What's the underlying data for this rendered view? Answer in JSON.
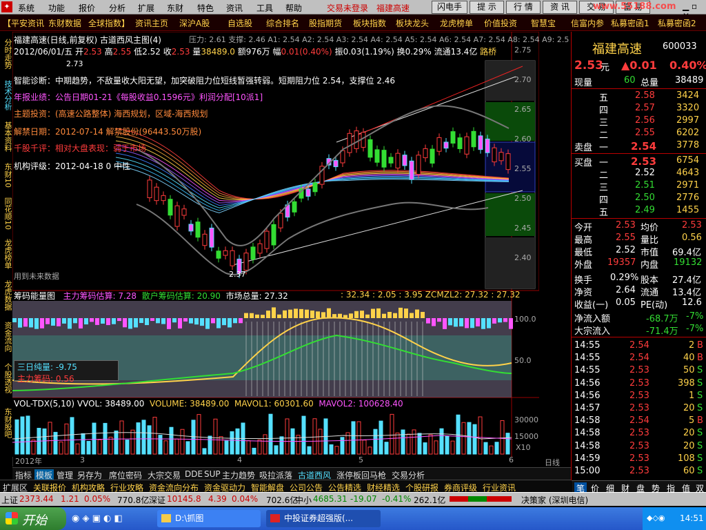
{
  "menubar": {
    "items": [
      "系统",
      "功能",
      "报价",
      "分析",
      "扩展",
      "东财",
      "特色",
      "资讯",
      "工具",
      "帮助"
    ],
    "status_login": "交易未登录",
    "status_stock": "福建高速",
    "tool_buttons": [
      "闪电手",
      "提 示",
      "行 情",
      "资 讯",
      "交 易",
      "富 易"
    ],
    "watermark": "www.55188.com"
  },
  "navbar": {
    "items": [
      "【平安资讯",
      "东财数据",
      "全球指数】",
      "资讯主页",
      "深沪A股",
      "自选股",
      "综合排名",
      "股指期货",
      "板块指数",
      "板块龙头",
      "龙虎榜单",
      "价值投资",
      "智慧宝",
      "信富内参",
      "私募密函1",
      "私募密函2"
    ]
  },
  "sidebar": {
    "tabs": [
      "分时走势",
      "技术分析",
      "基本资料",
      "东财10",
      "同花顺10",
      "龙虎榜单",
      "龙虎数据",
      "资金流向",
      "个股透视",
      "东财股吧"
    ]
  },
  "chart": {
    "title": "福建高速(日线,前复权) 古道西风主图(4)",
    "pressure": "压力: 2.61  支撑: 2.46  A1: 2.54  A2: 2.54  A3: 2.54  A4: 2.54  A5: 2.54  A6: 2.54  A7: 2.54  A8: 2.54  A9: 2.5",
    "ohlc_line": {
      "date": "2012/06/01/五",
      "open_label": "开",
      "open": "2.53",
      "high_label": "高",
      "high": "2.55",
      "low_label": "低",
      "low": "2.52",
      "close_label": "收",
      "close": "2.53",
      "vol_label": "量",
      "vol": "38489.0",
      "amount_label": "额",
      "amount": "976万",
      "change_label": "幅",
      "change": "0.01(0.40%)",
      "amp_label": "振",
      "amp": "0.03(1.19%)",
      "turn_label": "换",
      "turn": "0.29%",
      "float_label": "流通",
      "float": "13.4亿",
      "bridge_label": "路桥"
    },
    "notes": [
      "智能诊断：中期趋势，不敌量收大阳无望，加突破阻力位短线暂强转弱。短期阻力位 2.54，支撑位 2.46",
      "年报业绩：公告日期01-21《每股收益0.1596元》利润分配[10派1]",
      "主题投资：(高速公路整体) 海西规划，区域-海西规划",
      "解禁日期：2012-07-14 解禁股份(96443.50万股)",
      "千股千评：相对大盘表现：弱于市场",
      "机构评级：2012-04-18  0  中性"
    ],
    "use_future_note": "用到未来数据",
    "price_axis": [
      "2.75",
      "2.70",
      "2.65",
      "2.60",
      "2.55",
      "2.50",
      "2.45",
      "2.40"
    ],
    "high_mark": "2.73",
    "low_mark": "2.37",
    "chip_panel": {
      "title": "筹码能量图",
      "main_label": "主力筹码估算:",
      "main_val": "7.28",
      "retail_label": "散户筹码估算:",
      "retail_val": "20.90",
      "total_label": "市场总量:",
      "total_val": "27.32",
      "zcm_line": ": 32.34 : 2.05 : 3.95  ZCMZL2: 27.32 : 27.32",
      "axis": [
        "100.0",
        "50.0"
      ],
      "three_day_label": "三日纯量:",
      "three_day_val": "-9.75",
      "sub_label": "主力筹码:",
      "sub_val": "0.56"
    },
    "vol_panel": {
      "title": "VOL-TDX(5,10)",
      "vol_label": "VVOL:",
      "vol_val": "38489.00",
      "volume_label": "VOLUME:",
      "volume_val": "38489.00",
      "ma1_label": "MAVOL1:",
      "ma1_val": "60301.60",
      "ma2_label": "MAVOL2:",
      "ma2_val": "100628.40",
      "axis": [
        "30000",
        "15000",
        "X10"
      ]
    },
    "x_axis": [
      "2012年",
      "3",
      "4",
      "5",
      "6"
    ],
    "period": "日线"
  },
  "quote": {
    "name": "福建高速",
    "code": "600033",
    "price": "2.53",
    "unit": "元",
    "change": "▲0.01",
    "change_pct": "0.40%",
    "now_vol_label": "现量",
    "now_vol": "60",
    "total_vol_label": "总量",
    "total_vol": "38489",
    "sell": [
      {
        "level": "五",
        "price": "2.58",
        "vol": "3424"
      },
      {
        "level": "四",
        "price": "2.57",
        "vol": "3320"
      },
      {
        "level": "三",
        "price": "2.56",
        "vol": "2997"
      },
      {
        "level": "二",
        "price": "2.55",
        "vol": "6202"
      },
      {
        "level": "一",
        "price": "2.54",
        "vol": "3778"
      }
    ],
    "sell_label": "卖盘",
    "buy_label": "买盘",
    "buy": [
      {
        "level": "一",
        "price": "2.53",
        "vol": "6754"
      },
      {
        "level": "二",
        "price": "2.52",
        "vol": "4643"
      },
      {
        "level": "三",
        "price": "2.51",
        "vol": "2971"
      },
      {
        "level": "四",
        "price": "2.50",
        "vol": "2776"
      },
      {
        "level": "五",
        "price": "2.49",
        "vol": "1455"
      }
    ],
    "stats": [
      {
        "l1": "今开",
        "v1": "2.53",
        "l2": "均价",
        "v2": "2.53"
      },
      {
        "l1": "最高",
        "v1": "2.55",
        "l2": "量比",
        "v2": "0.56"
      },
      {
        "l1": "最低",
        "v1": "2.52",
        "l2": "市值",
        "v2": "69.4亿"
      },
      {
        "l1": "外盘",
        "v1": "19357",
        "l2": "内盘",
        "v2": "19132"
      },
      {
        "l1": "换手",
        "v1": "0.29%",
        "l2": "股本",
        "v2": "27.4亿"
      },
      {
        "l1": "净资",
        "v1": "2.64",
        "l2": "流通",
        "v2": "13.4亿"
      },
      {
        "l1": "收益(一)",
        "v1": "0.05",
        "l2": "PE(动)",
        "v2": "12.6"
      }
    ],
    "net_inflow_label": "净流入额",
    "net_inflow": "-68.7万",
    "net_inflow_pct": "-7%",
    "block_inflow_label": "大宗流入",
    "block_inflow": "-71.4万",
    "block_inflow_pct": "-7%",
    "ticks": [
      {
        "t": "14:55",
        "p": "2.54",
        "v": "2",
        "s": "B"
      },
      {
        "t": "14:55",
        "p": "2.54",
        "v": "40",
        "s": "B"
      },
      {
        "t": "14:55",
        "p": "2.53",
        "v": "50",
        "s": "S"
      },
      {
        "t": "14:56",
        "p": "2.53",
        "v": "398",
        "s": "S"
      },
      {
        "t": "14:56",
        "p": "2.53",
        "v": "1",
        "s": "S"
      },
      {
        "t": "14:57",
        "p": "2.53",
        "v": "20",
        "s": "S"
      },
      {
        "t": "14:58",
        "p": "2.54",
        "v": "5",
        "s": "B"
      },
      {
        "t": "14:58",
        "p": "2.53",
        "v": "20",
        "s": "S"
      },
      {
        "t": "14:58",
        "p": "2.53",
        "v": "20",
        "s": "S"
      },
      {
        "t": "14:59",
        "p": "2.53",
        "v": "108",
        "s": "S"
      },
      {
        "t": "15:00",
        "p": "2.53",
        "v": "60",
        "s": "S"
      }
    ],
    "bottom_tabs": [
      "笔",
      "价",
      "细",
      "财",
      "盘",
      "势",
      "指",
      "值",
      "双"
    ]
  },
  "tabbar1": [
    "指标",
    "模板",
    "管理",
    "另存为",
    "席位密码",
    "大宗交易",
    "DDE",
    "SUP",
    "主力趋势",
    "吸拉派落",
    "古道西风",
    "涨停板回马枪",
    "交易分析"
  ],
  "tabbar1_active": "古道西风",
  "tabbar2": [
    "扩展区",
    "关联报价",
    "机构攻略",
    "行业攻略",
    "资金流向分布",
    "资金驱动力",
    "智能解盘",
    "公司公告",
    "公告精选",
    "财经精选",
    "个股研报",
    "券商评级",
    "行业资讯"
  ],
  "indexbar": {
    "sh_label": "上证",
    "sh_val": "2373.44",
    "sh_chg": "1.21",
    "sh_pct": "0.05%",
    "sh_amt": "770.8亿",
    "sz_label": "深证",
    "sz_val": "10145.8",
    "sz_chg": "4.39",
    "sz_pct": "0.04%",
    "sz_amt": "702.6亿",
    "zx_label": "中小",
    "zx_val": "4685.31",
    "zx_chg": "-19.07",
    "zx_pct": "-0.41%",
    "zx_amt": "262.1亿",
    "right": "决策家 (深圳电信)"
  },
  "taskbar": {
    "start": "开始",
    "task1": "D:\\抓图",
    "task2": "中投证券超强版(...",
    "clock": "14:51"
  }
}
